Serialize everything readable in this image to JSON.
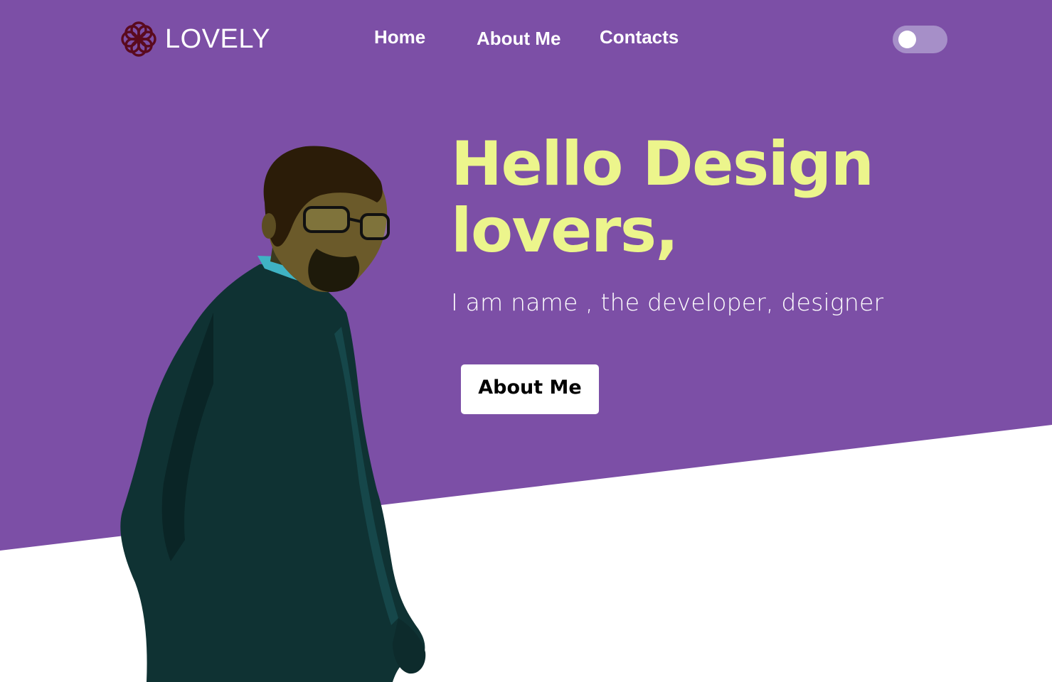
{
  "colors": {
    "background_purple": "#7c4fa6",
    "accent_yellow": "#ecf58c",
    "toggle_track": "#a68fc8",
    "logo_maroon": "#5a0a1e",
    "white": "#ffffff"
  },
  "header": {
    "logo_icon": "flower-knot-icon",
    "logo_text": "LOVELY",
    "nav": {
      "home": "Home",
      "about": "About Me",
      "contacts": "Contacts"
    },
    "theme_toggle": {
      "state": "off"
    }
  },
  "hero": {
    "title_line1": "Hello Design",
    "title_line2": "lovers,",
    "subtitle": "I am name , the developer, designer",
    "cta_label": "About Me",
    "portrait": "man-in-dark-suit-with-glasses-looking-over-shoulder"
  }
}
